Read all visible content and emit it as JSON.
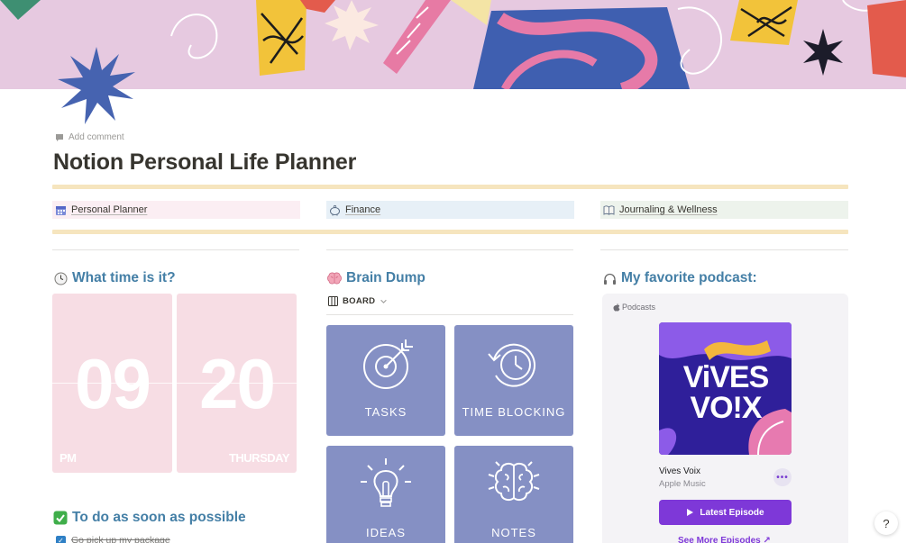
{
  "header": {
    "add_comment": "Add comment",
    "title": "Notion Personal Life Planner"
  },
  "nav": [
    {
      "label": "Personal Planner",
      "icon": "calendar-icon",
      "bg": "#fbeef3"
    },
    {
      "label": "Finance",
      "icon": "piggy-bank-icon",
      "bg": "#e7f0f7"
    },
    {
      "label": "Journaling & Wellness",
      "icon": "book-icon",
      "bg": "#edf3ec"
    }
  ],
  "clock": {
    "title": "What time is it?",
    "hour": "09",
    "minute": "20",
    "period": "PM",
    "weekday": "THURSDAY"
  },
  "brain_dump": {
    "title": "Brain Dump",
    "view": "BOARD",
    "cards": [
      {
        "label": "TASKS",
        "icon": "target-icon"
      },
      {
        "label": "TIME BLOCKING",
        "icon": "clock-history-icon"
      },
      {
        "label": "IDEAS",
        "icon": "lightbulb-icon"
      },
      {
        "label": "NOTES",
        "icon": "brain-icon"
      }
    ]
  },
  "podcast": {
    "title": "My favorite podcast:",
    "brand": "Podcasts",
    "art_text": "ViVES VO!X",
    "name": "Vives Voix",
    "app": "Apple Music",
    "latest": "Latest Episode",
    "see_more": "See More Episodes"
  },
  "todo": {
    "title": "To do as soon as possible",
    "items": [
      {
        "text": "Go pick up my package",
        "checked": true
      }
    ]
  },
  "help": "?",
  "colors": {
    "accent_blue": "#447fa6",
    "separator": "#f6e5be",
    "card": "#8590c4",
    "clock": "#f7dde4",
    "apple_purple": "#7e38d8"
  }
}
